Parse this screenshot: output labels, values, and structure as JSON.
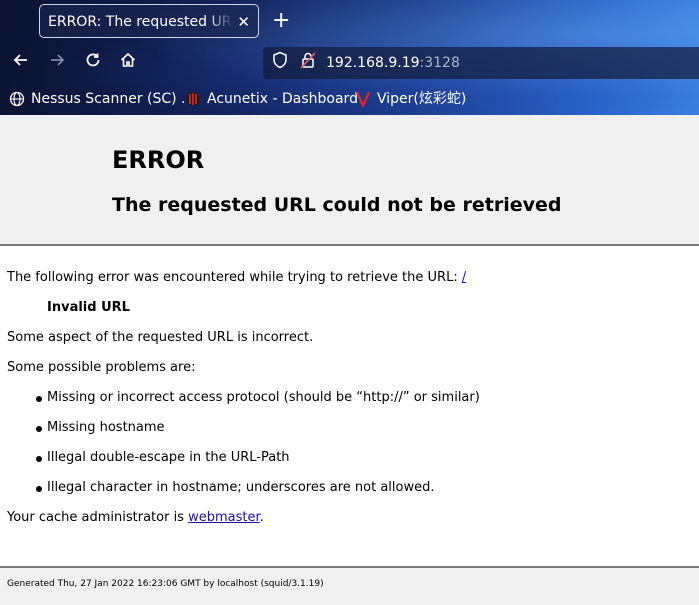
{
  "browser": {
    "tab_title": "ERROR: The requested URL could not be retrieved",
    "tab_close": "✕",
    "new_tab": "+",
    "url_host": "192.168.9.19",
    "url_port": ":3128",
    "icons": {
      "back": "back-arrow-icon",
      "forward": "forward-arrow-icon",
      "reload": "reload-icon",
      "home": "home-icon",
      "shield": "shield-icon",
      "lock": "lock-icon"
    },
    "bookmarks": [
      {
        "label": "Nessus Scanner (SC) ...",
        "icon": "globe-icon"
      },
      {
        "label": "Acunetix - Dashboard",
        "icon": "acunetix-logo-icon"
      },
      {
        "label": "Viper(炫彩蛇)",
        "icon": "viper-logo-icon",
        "icon_color": "#e0242b"
      }
    ]
  },
  "page": {
    "title": "ERROR",
    "subtitle": "The requested URL could not be retrieved",
    "intro": "The following error was encountered while trying to retrieve the URL:",
    "intro_link": "/",
    "error_name": "Invalid URL",
    "description": "Some aspect of the requested URL is incorrect.",
    "problems_heading": "Some possible problems are:",
    "problems": [
      "Missing or incorrect access protocol (should be “http://” or similar)",
      "Missing hostname",
      "Illegal double-escape in the URL-Path",
      "Illegal character in hostname; underscores are not allowed."
    ],
    "admin_prefix": "Your cache administrator is",
    "admin_link": "webmaster",
    "admin_suffix": ".",
    "footer": "Generated Thu, 27 Jan 2022 16:23:06 GMT by localhost (squid/3.1.19)"
  },
  "colors": {
    "header_bg": "#f0f0f0",
    "link": "#1a0dab",
    "divider": "#7a7a7a"
  }
}
